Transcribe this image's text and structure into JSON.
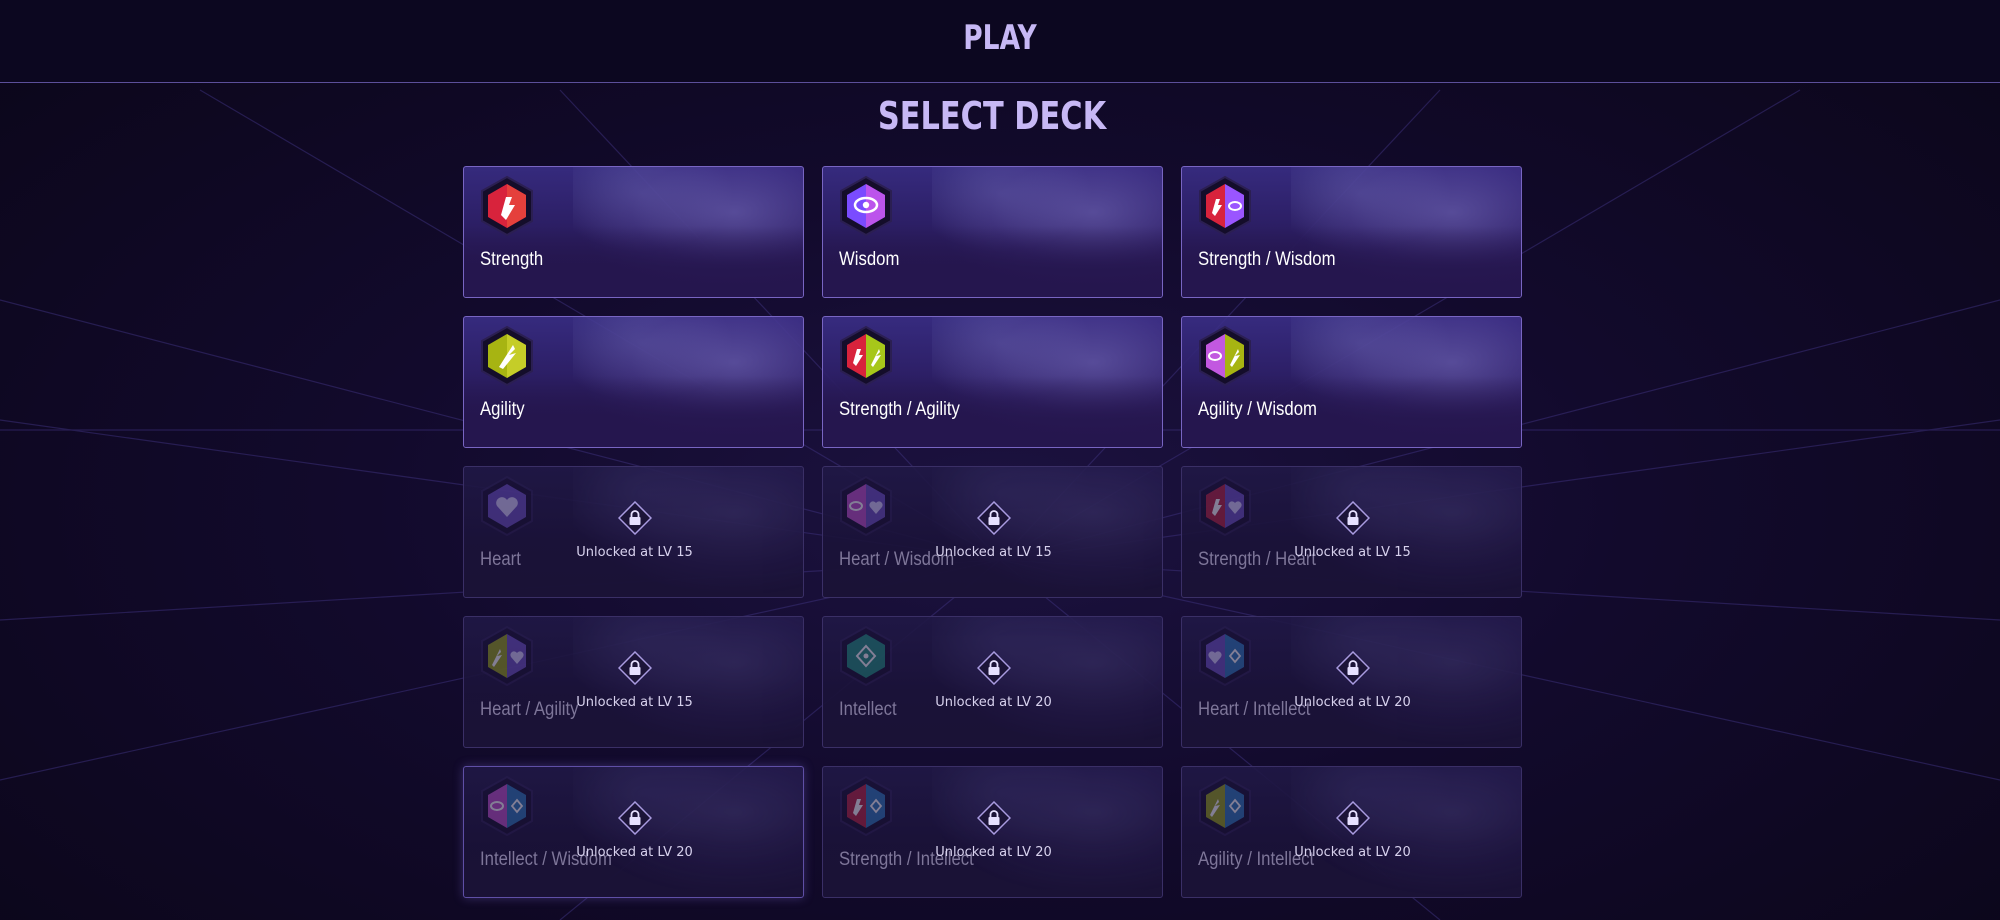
{
  "header": {
    "title": "PLAY"
  },
  "section": {
    "title": "SELECT DECK"
  },
  "colors": {
    "accent": "#c7b8f5",
    "card_border": "#7865c2",
    "background": "#0d0820"
  },
  "decks": [
    {
      "name": "Strength",
      "locked": false,
      "emblem": "strength-emblem-icon",
      "colors": [
        "#d8233c",
        "#ff6a3a"
      ]
    },
    {
      "name": "Wisdom",
      "locked": false,
      "emblem": "wisdom-emblem-icon",
      "colors": [
        "#7a4cff",
        "#e85adf"
      ]
    },
    {
      "name": "Strength / Wisdom",
      "locked": false,
      "emblem": "strength-wisdom-emblem-icon",
      "colors": [
        "#d8233c",
        "#9a55ff"
      ]
    },
    {
      "name": "Agility",
      "locked": false,
      "emblem": "agility-emblem-icon",
      "colors": [
        "#b6c414",
        "#dfe23a"
      ]
    },
    {
      "name": "Strength / Agility",
      "locked": false,
      "emblem": "strength-agility-emblem-icon",
      "colors": [
        "#d8233c",
        "#a7c71a"
      ]
    },
    {
      "name": "Agility / Wisdom",
      "locked": false,
      "emblem": "agility-wisdom-emblem-icon",
      "colors": [
        "#9a55ff",
        "#b6c414"
      ]
    },
    {
      "name": "Heart",
      "locked": true,
      "lock_text": "Unlocked at LV 15",
      "emblem": "heart-emblem-icon",
      "colors": [
        "#8c6bd8",
        "#a88df0"
      ]
    },
    {
      "name": "Heart / Wisdom",
      "locked": true,
      "lock_text": "Unlocked at LV 15",
      "emblem": "heart-wisdom-emblem-icon",
      "colors": [
        "#d24fd6",
        "#8c6bd8"
      ]
    },
    {
      "name": "Strength / Heart",
      "locked": true,
      "lock_text": "Unlocked at LV 15",
      "emblem": "strength-heart-emblem-icon",
      "colors": [
        "#c8243d",
        "#8c6bd8"
      ]
    },
    {
      "name": "Heart / Agility",
      "locked": true,
      "lock_text": "Unlocked at LV 15",
      "emblem": "heart-agility-emblem-icon",
      "colors": [
        "#aab816",
        "#8c6bd8"
      ]
    },
    {
      "name": "Intellect",
      "locked": true,
      "lock_text": "Unlocked at LV 20",
      "emblem": "intellect-emblem-icon",
      "colors": [
        "#1fa38a",
        "#2fc0a6"
      ]
    },
    {
      "name": "Heart / Intellect",
      "locked": true,
      "lock_text": "Unlocked at LV 20",
      "emblem": "heart-intellect-emblem-icon",
      "colors": [
        "#8c6bd8",
        "#2a86c9"
      ]
    },
    {
      "name": "Intellect / Wisdom",
      "locked": true,
      "lock_text": "Unlocked at LV 20",
      "emblem": "intellect-wisdom-emblem-icon",
      "colors": [
        "#d24fd6",
        "#2a86c9"
      ]
    },
    {
      "name": "Strength / Intellect",
      "locked": true,
      "lock_text": "Unlocked at LV 20",
      "emblem": "strength-intellect-emblem-icon",
      "colors": [
        "#c8243d",
        "#2a86c9"
      ]
    },
    {
      "name": "Agility / Intellect",
      "locked": true,
      "lock_text": "Unlocked at LV 20",
      "emblem": "agility-intellect-emblem-icon",
      "colors": [
        "#aab816",
        "#2a86c9"
      ]
    }
  ],
  "icons": {
    "lock": "lock-icon"
  }
}
